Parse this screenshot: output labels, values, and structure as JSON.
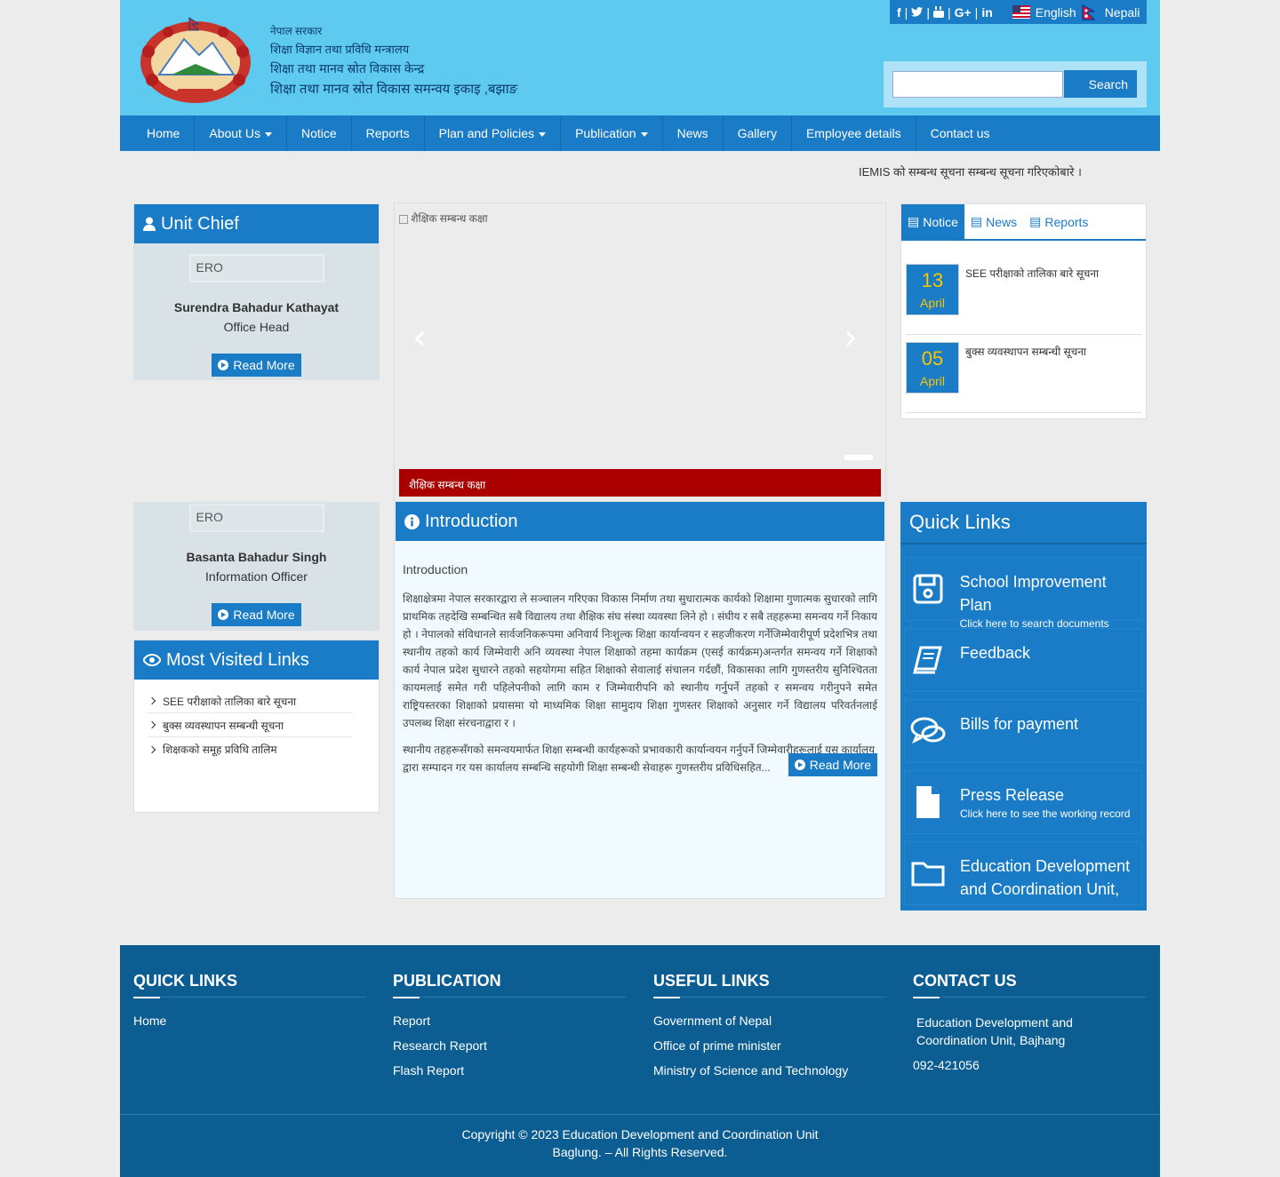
{
  "header": {
    "gov_line1": "नेपाल सरकार",
    "gov_line2": "शिक्षा विज्ञान तथा प्रविधि मन्त्रालय",
    "gov_line3": "शिक्षा तथा मानव स्रोत विकास केन्द्र",
    "gov_line4": "शिक्षा तथा मानव स्रोत विकास समन्वय इकाइ ,बझाङ",
    "lang_english": "English",
    "lang_nepali": "Nepali",
    "search_button": "Search",
    "search_placeholder": ""
  },
  "nav": {
    "items": [
      "Home",
      "About Us",
      "Notice",
      "Reports",
      "Plan and Policies",
      "Publication",
      "News",
      "Gallery",
      "Employee details",
      "Contact us"
    ]
  },
  "ticker": {
    "text": "IEMIS को सम्बन्ध सूचना सम्बन्ध सूचना गरिएकोबारे ।"
  },
  "unit_chief": {
    "title": "Unit Chief",
    "img_alt": "ERO",
    "name": "Surendra Bahadur Kathayat",
    "role": "Office Head",
    "read_more": "Read More"
  },
  "info_officer": {
    "img_alt": "ERO",
    "name": "Basanta Bahadur Singh",
    "role": "Information Officer",
    "read_more": "Read More"
  },
  "slider": {
    "img_alt": "शैक्षिक सम्बन्ध कक्षा",
    "caption": "शैक्षिक सम्बन्ध कक्षा"
  },
  "notice_tabs": {
    "tabs": [
      "Notice",
      "News",
      "Reports"
    ],
    "items": [
      {
        "day": "13",
        "month": "April",
        "title": "SEE परीक्षाको तालिका बारे सूचना"
      },
      {
        "day": "05",
        "month": "April",
        "title": "बुक्स व्यवस्थापन सम्बन्धी सूचना"
      }
    ]
  },
  "most_visited": {
    "title": "Most Visited Links",
    "items": [
      "SEE परीक्षाको तालिका बारे सूचना",
      "बुक्स व्यवस्थापन सम्बन्धी सूचना",
      "शिक्षकको समूह प्रविधि तालिम"
    ]
  },
  "introduction": {
    "title": "Introduction",
    "subtitle": "Introduction",
    "para1": "शिक्षाक्षेत्रमा नेपाल सरकारद्वारा ले सञ्चालन गरिएका विकास निर्माण तथा सुधारात्मक कार्यको शिक्षामा गुणात्मक सुधारको लागि प्राथमिक तहदेखि सम्बन्धित सबै विद्यालय तथा शैक्षिक संघ संस्था व्यवस्था लिने हो । संघीय र सबै तहहरूमा समन्वय गर्ने निकाय हो । नेपालको संविधानले सार्वजनिकरूपमा अनिवार्य निःशुल्क शिक्षा कार्यान्वयन र सहजीकरण गर्नेजिम्मेवारीपूर्ण प्रदेशभित्र तथा स्थानीय तहको कार्य जिम्मेवारी अनि व्यवस्था नेपाल शिक्षाको तहमा कार्यक्रम (एसई कार्यक्रम)अन्तर्गत समन्वय गर्ने शिक्षाको कार्य नेपाल प्रदेश सुधारने तहको सहयोगमा सहित शिक्षाको सेवालाई संचालन गर्दछौं, विकासका लागि गुणस्तरीय सुनिश्चितता कायमलाई समेत गरी पहिलेपनीको लागि काम र जिम्मेवारीपनि को स्थानीय गर्नुपर्ने तहको र समन्वय गरीनुपने  समेत राष्ट्रियस्तरका शिक्षाको प्रयासमा यो माध्यमिक शिक्षा सामुदाय शिक्षा गुणस्तर शिक्षाको अनुसार गर्ने विद्यालय परिवर्तनलाई उपलब्ध शिक्षा संरचनाद्वारा र ।",
    "para2": "स्थानीय तहहरूसँगको समन्वयमार्फत शिक्षा सम्बन्धी कार्यहरूको प्रभावकारी कार्यान्वयन गर्नुपर्ने जिम्मेवारीहरूलाई यस कार्यालय द्वारा सम्पादन गर यस कार्यालय सम्बन्धि सहयोगी शिक्षा सम्बन्धी सेवाहरू गुणस्तरीय प्रविधिसहित...",
    "read_more": "Read More"
  },
  "quick_links": {
    "title": "Quick Links",
    "items": [
      {
        "title": "School Improvement Plan",
        "sub": "Click here to search documents",
        "icon": "save-icon"
      },
      {
        "title": "Feedback",
        "sub": "",
        "icon": "book-icon"
      },
      {
        "title": "Bills for payment",
        "sub": "",
        "icon": "comments-icon"
      },
      {
        "title": "Press Release",
        "sub": "Click here to see the working record",
        "icon": "file-icon"
      },
      {
        "title": "Education Development and Coordination Unit, Bajhang",
        "sub": "",
        "icon": "folder-icon"
      }
    ]
  },
  "footer": {
    "quick_links": {
      "title": "QUICK LINKS",
      "items": [
        "Home"
      ]
    },
    "publication": {
      "title": "PUBLICATION",
      "items": [
        "Report",
        "Research Report",
        "Flash Report"
      ]
    },
    "useful_links": {
      "title": "USEFUL LINKS",
      "items": [
        "Government of Nepal",
        "Office of prime minister",
        "Ministry of Science and Technology"
      ]
    },
    "contact": {
      "title": "CONTACT US",
      "address": "Education Development and Coordination Unit, Bajhang",
      "phone": "092-421056"
    },
    "copyright_line1": "Copyright © 2023 Education Development and Coordination Unit",
    "copyright_line2": "Baglung. – All Rights Reserved."
  }
}
